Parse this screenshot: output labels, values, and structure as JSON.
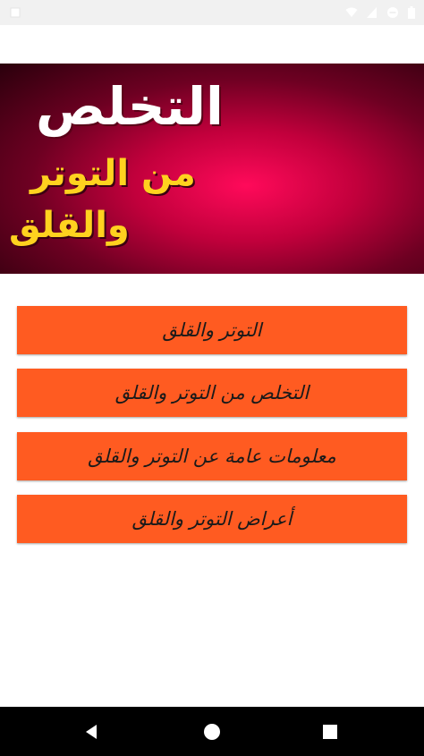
{
  "status_bar": {
    "icons": [
      "notification-icon",
      "wifi-icon",
      "cellular-signal-icon",
      "block-icon",
      "battery-icon"
    ]
  },
  "banner": {
    "line_1": "التخلص",
    "line_2": "من التوتر",
    "line_3": "والقلق",
    "colors": {
      "background": "#c2003c",
      "title": "#ffffff",
      "subtitle": "#ffd21f"
    }
  },
  "menu": {
    "items": [
      {
        "label": "التوتر والقلق"
      },
      {
        "label": "التخلص من التوتر والقلق"
      },
      {
        "label": "معلومات عامة عن  التوتر والقلق"
      },
      {
        "label": "أعراض التوتر والقلق"
      }
    ],
    "colors": {
      "button": "#ff5b21",
      "text": "#1a1a1a"
    }
  },
  "nav_bar": {
    "icons": [
      "back-icon",
      "home-icon",
      "recent-apps-icon"
    ]
  }
}
